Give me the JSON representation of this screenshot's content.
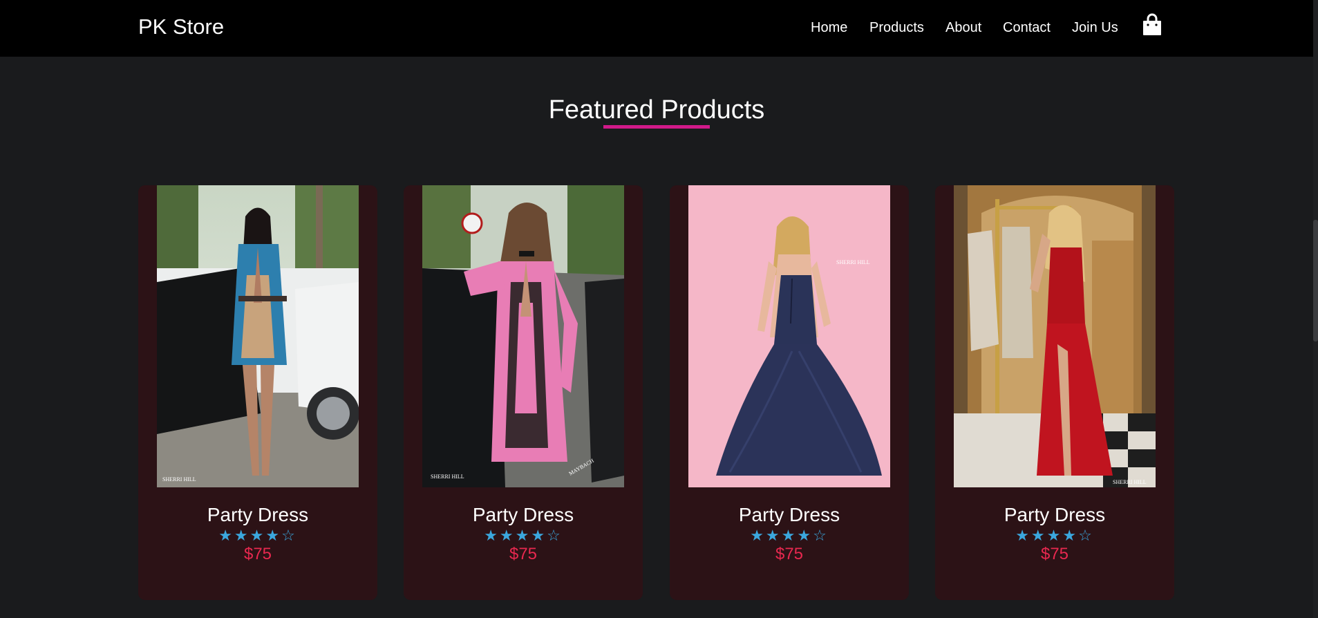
{
  "header": {
    "brand": "PK Store",
    "nav": [
      "Home",
      "Products",
      "About",
      "Contact",
      "Join Us"
    ],
    "cart_icon": "shopping-bag-icon"
  },
  "section": {
    "title": "Featured Products",
    "underline_color": "#d11a8a"
  },
  "products": [
    {
      "name": "Party Dress",
      "rating": "★★★★☆",
      "rating_value": 4,
      "rating_max": 5,
      "price": "$75",
      "watermark": "SHERRI HILL",
      "image": "model in blue patterned mini dress beside white car"
    },
    {
      "name": "Party Dress",
      "rating": "★★★★☆",
      "rating_value": 4,
      "rating_max": 5,
      "price": "$75",
      "watermark": "SHERRI HILL",
      "watermark2": "MAYBACH",
      "image": "model in pink patterned mini dress beside black car"
    },
    {
      "name": "Party Dress",
      "rating": "★★★★☆",
      "rating_value": 4,
      "rating_max": 5,
      "price": "$75",
      "watermark": "SHERRI HILL",
      "image": "navy ball gown on pink backdrop"
    },
    {
      "name": "Party Dress",
      "rating": "★★★★☆",
      "rating_value": 4,
      "rating_max": 5,
      "price": "$75",
      "watermark": "SHERRI HILL",
      "image": "red sequin gown in hotel lobby"
    }
  ],
  "colors": {
    "background": "#1a1b1d",
    "header_bg": "#000000",
    "card_bg": "#2c1216",
    "star": "#3ba7de",
    "price": "#e8284f"
  }
}
